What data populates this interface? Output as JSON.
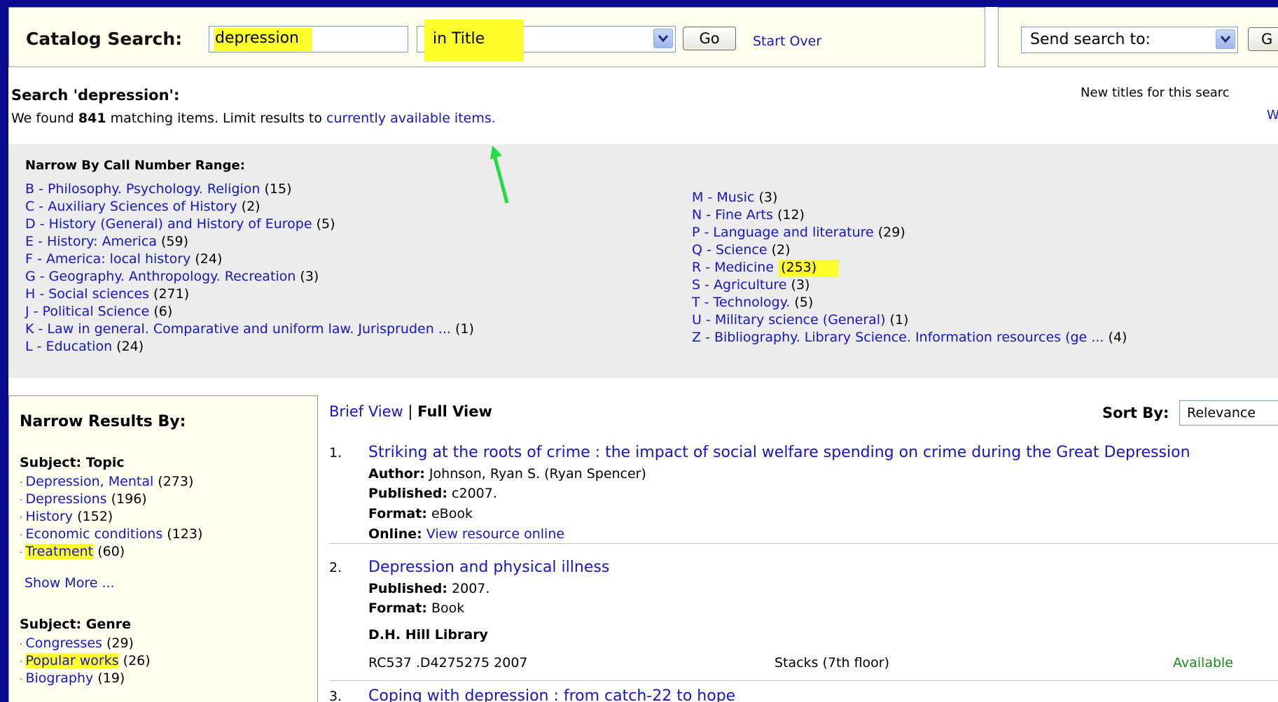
{
  "search": {
    "label": "Catalog Search:",
    "query": "depression",
    "field": "in Title",
    "go_label": "Go",
    "start_over": "Start Over"
  },
  "send": {
    "label": "Send search to:",
    "go_label": "G"
  },
  "summary": {
    "title": "Search 'depression':",
    "found_prefix": "We found",
    "count": "841",
    "found_mid": "matching items. Limit results to",
    "limit_link": "currently available items.",
    "new_titles": "New titles for this searc",
    "edge_char": "W"
  },
  "call_numbers": {
    "heading": "Narrow By Call Number Range:",
    "left": [
      {
        "label": "B - Philosophy. Psychology. Religion",
        "count": "(15)"
      },
      {
        "label": "C - Auxiliary Sciences of History",
        "count": "(2)"
      },
      {
        "label": "D - History (General) and History of Europe",
        "count": "(5)"
      },
      {
        "label": "E - History: America",
        "count": "(59)"
      },
      {
        "label": "F - America: local history",
        "count": "(24)"
      },
      {
        "label": "G - Geography. Anthropology. Recreation",
        "count": "(3)"
      },
      {
        "label": "H - Social sciences",
        "count": "(271)"
      },
      {
        "label": "J - Political Science",
        "count": "(6)"
      },
      {
        "label": "K - Law in general. Comparative and uniform law. Jurispruden ...",
        "count": "(1)"
      },
      {
        "label": "L - Education",
        "count": "(24)"
      }
    ],
    "right": [
      {
        "label": "M - Music",
        "count": "(3)"
      },
      {
        "label": "N - Fine Arts",
        "count": "(12)"
      },
      {
        "label": "P - Language and literature",
        "count": "(29)"
      },
      {
        "label": "Q - Science",
        "count": "(2)"
      },
      {
        "label": "R - Medicine",
        "count": "(253)"
      },
      {
        "label": "S - Agriculture",
        "count": "(3)"
      },
      {
        "label": "T - Technology.",
        "count": "(5)"
      },
      {
        "label": "U - Military science (General)",
        "count": "(1)"
      },
      {
        "label": "Z - Bibliography. Library Science. Information resources (ge ...",
        "count": "(4)"
      }
    ]
  },
  "sidebar": {
    "title": "Narrow Results By:",
    "topic_heading": "Subject: Topic",
    "topics": [
      {
        "label": "Depression, Mental",
        "count": "(273)"
      },
      {
        "label": "Depressions",
        "count": "(196)"
      },
      {
        "label": "History",
        "count": "(152)"
      },
      {
        "label": "Economic conditions",
        "count": "(123)"
      },
      {
        "label": "Treatment",
        "count": "(60)"
      }
    ],
    "show_more": "Show More ...",
    "genre_heading": "Subject: Genre",
    "genres": [
      {
        "label": "Congresses",
        "count": "(29)"
      },
      {
        "label": "Popular works",
        "count": "(26)"
      },
      {
        "label": "Biography",
        "count": "(19)"
      }
    ]
  },
  "results": {
    "brief_view": "Brief View",
    "separator": "|",
    "full_view": "Full View",
    "sort_label": "Sort By:",
    "sort_value": "Relevance",
    "items": [
      {
        "num": "1.",
        "title": "Striking at the roots of crime : the impact of social welfare spending on crime during the Great Depression",
        "author_label": "Author:",
        "author": "Johnson, Ryan S. (Ryan Spencer)",
        "published_label": "Published:",
        "published": "c2007.",
        "format_label": "Format:",
        "format": "eBook",
        "online_label": "Online:",
        "online": "View resource online"
      },
      {
        "num": "2.",
        "title": "Depression and physical illness",
        "published_label": "Published:",
        "published": "2007.",
        "format_label": "Format:",
        "format": "Book",
        "library": "D.H. Hill Library",
        "call_number": "RC537 .D4275275 2007",
        "location": "Stacks (7th floor)",
        "status": "Available"
      },
      {
        "num": "3.",
        "title": "Coping with depression : from catch-22 to hope"
      }
    ]
  },
  "colors": {
    "frame": "#0a0a8c",
    "highlight": "#ffff2e",
    "link": "#1515c9",
    "available": "#1a8a1a",
    "arrow": "#22dd44"
  }
}
